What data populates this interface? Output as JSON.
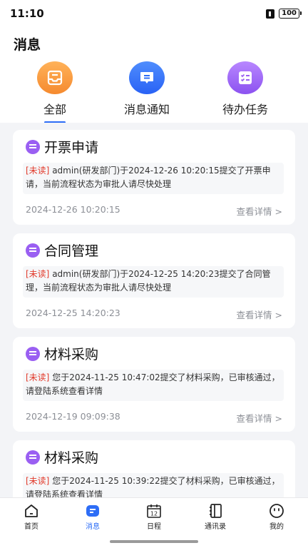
{
  "status_bar": {
    "time": "11:10",
    "battery": "100"
  },
  "page": {
    "title": "消息"
  },
  "tabs": [
    {
      "label": "全部",
      "icon": "inbox-icon",
      "color": "#f5902f",
      "active": true
    },
    {
      "label": "消息通知",
      "icon": "chat-bubble-icon",
      "color": "#2d6df6",
      "active": false
    },
    {
      "label": "待办任务",
      "icon": "task-list-icon",
      "color": "#9a5ff2",
      "active": false
    }
  ],
  "messages": [
    {
      "title": "开票申请",
      "unread_tag": "[未读]",
      "body": " admin(研发部门)于2024-12-26 10:20:15提交了开票申请，当前流程状态为审批人请尽快处理",
      "date": "2024-12-26 10:20:15",
      "detail": "查看详情 >"
    },
    {
      "title": "合同管理",
      "unread_tag": "[未读]",
      "body": " admin(研发部门)于2024-12-25 14:20:23提交了合同管理，当前流程状态为审批人请尽快处理",
      "date": "2024-12-25 14:20:23",
      "detail": "查看详情 >"
    },
    {
      "title": "材料采购",
      "unread_tag": "[未读]",
      "body": " 您于2024-11-25 10:47:02提交了材料采购，已审核通过，请登陆系统查看详情",
      "date": "2024-12-19 09:09:38",
      "detail": "查看详情 >"
    },
    {
      "title": "材料采购",
      "unread_tag": "[未读]",
      "body": " 您于2024-11-25 10:39:22提交了材料采购，已审核通过，请登陆系统查看详情",
      "date": "",
      "detail": ""
    }
  ],
  "bottom_nav": [
    {
      "label": "首页",
      "icon": "home-icon",
      "active": false
    },
    {
      "label": "消息",
      "icon": "message-icon",
      "active": true
    },
    {
      "label": "日程",
      "icon": "calendar-icon",
      "calendar_day": "12",
      "active": false
    },
    {
      "label": "通讯录",
      "icon": "contacts-icon",
      "active": false
    },
    {
      "label": "我的",
      "icon": "profile-face-icon",
      "active": false
    }
  ],
  "colors": {
    "accent": "#2d6df6",
    "unread": "#e23b2c",
    "list_background": "#f3f4f7"
  }
}
